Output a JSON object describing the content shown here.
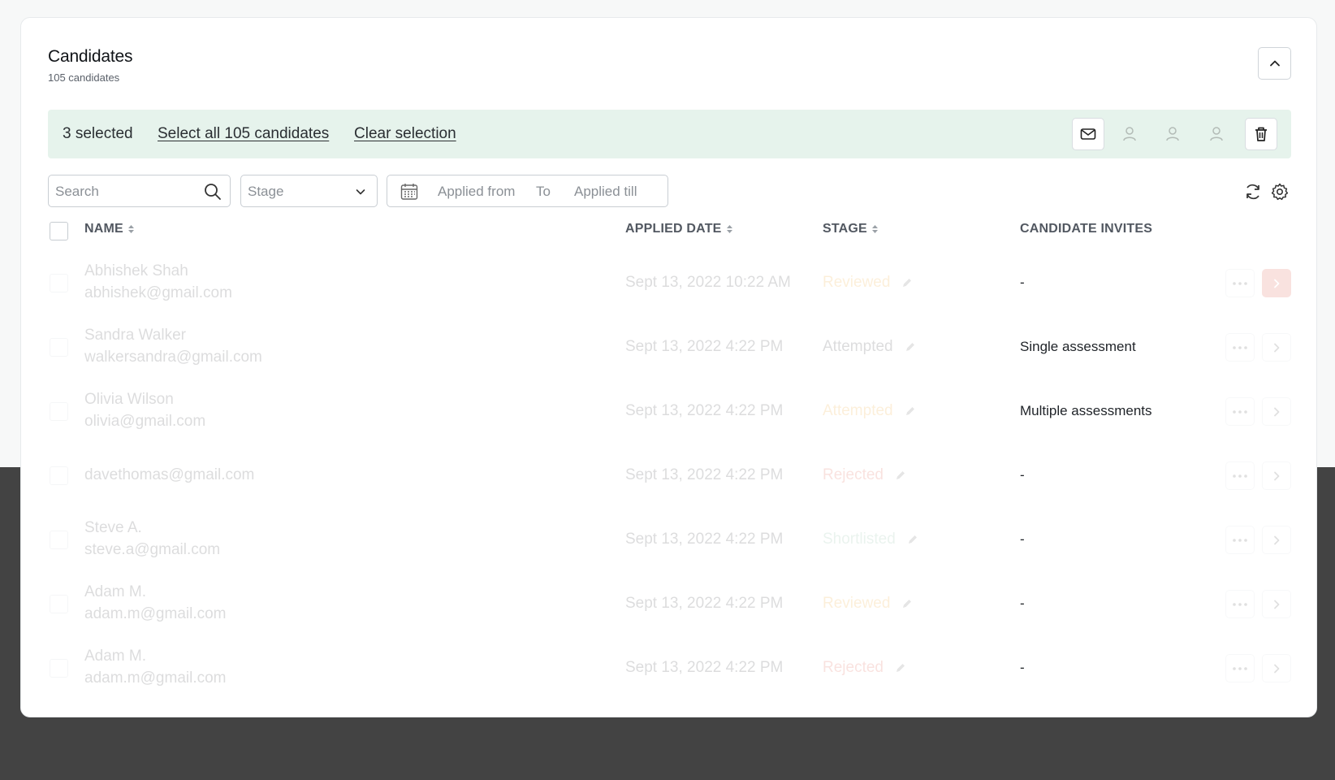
{
  "header": {
    "title": "Candidates",
    "subtitle": "105 candidates"
  },
  "selection": {
    "count_label": "3 selected",
    "select_all_label": "Select all 105 candidates",
    "clear_label": "Clear selection"
  },
  "filters": {
    "search_placeholder": "Search",
    "stage_placeholder": "Stage",
    "applied_from_placeholder": "Applied from",
    "to_label": "To",
    "applied_till_placeholder": "Applied till"
  },
  "table": {
    "columns": {
      "name": "NAME",
      "applied_date": "APPLIED DATE",
      "stage": "STAGE",
      "candidate_invites": "CANDIDATE INVITES"
    },
    "rows": [
      {
        "name": "Abhishek Shah",
        "email": "abhishek@gmail.com",
        "date": "Sept 13, 2022 10:22 AM",
        "stage": "Reviewed",
        "stage_color": "#f0a020",
        "invites": "-"
      },
      {
        "name": "Sandra Walker",
        "email": "walkersandra@gmail.com",
        "date": "Sept 13, 2022 4:22 PM",
        "stage": "Attempted",
        "stage_color": "#2b2f33",
        "invites": "Single assessment"
      },
      {
        "name": "Olivia Wilson",
        "email": "olivia@gmail.com",
        "date": "Sept 13, 2022 4:22 PM",
        "stage": "Attempted",
        "stage_color": "#f0a020",
        "invites": "Multiple assessments"
      },
      {
        "name": "",
        "email": "davethomas@gmail.com",
        "date": "Sept 13, 2022 4:22 PM",
        "stage": "Rejected",
        "stage_color": "#e0533f",
        "invites": "-"
      },
      {
        "name": "Steve A.",
        "email": "steve.a@gmail.com",
        "date": "Sept 13, 2022 4:22 PM",
        "stage": "Shortlisted",
        "stage_color": "#7fb89a",
        "invites": "-"
      },
      {
        "name": "Adam M.",
        "email": "adam.m@gmail.com",
        "date": "Sept 13, 2022 4:22 PM",
        "stage": "Reviewed",
        "stage_color": "#f0a020",
        "invites": "-"
      },
      {
        "name": "Adam M.",
        "email": "adam.m@gmail.com",
        "date": "Sept 13, 2022 4:22 PM",
        "stage": "Rejected",
        "stage_color": "#e0533f",
        "invites": "-"
      }
    ]
  },
  "colors": {
    "accent": "#e0533f",
    "selection_bar": "#e6f3ec",
    "background_dark": "#434343"
  }
}
